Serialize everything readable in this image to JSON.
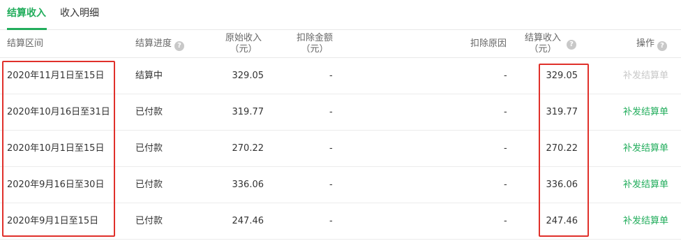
{
  "tabs": [
    {
      "label": "结算收入",
      "active": true
    },
    {
      "label": "收入明细",
      "active": false
    }
  ],
  "columns": {
    "period": "结算区间",
    "progress": "结算进度",
    "original_income": "原始收入",
    "original_income_unit": "（元）",
    "deduction_amount": "扣除金额",
    "deduction_amount_unit": "（元）",
    "deduction_reason": "扣除原因",
    "settled_income": "结算收入",
    "settled_income_unit": "（元）",
    "operation": "操作"
  },
  "help_icon": "question-circle-icon",
  "rows": [
    {
      "period": "2020年11月1日至15日",
      "progress": "结算中",
      "original": "329.05",
      "deduction": "-",
      "reason": "-",
      "settled": "329.05",
      "action": "补发结算单",
      "action_enabled": false
    },
    {
      "period": "2020年10月16日至31日",
      "progress": "已付款",
      "original": "319.77",
      "deduction": "-",
      "reason": "-",
      "settled": "319.77",
      "action": "补发结算单",
      "action_enabled": true
    },
    {
      "period": "2020年10月1日至15日",
      "progress": "已付款",
      "original": "270.22",
      "deduction": "-",
      "reason": "-",
      "settled": "270.22",
      "action": "补发结算单",
      "action_enabled": true
    },
    {
      "period": "2020年9月16日至30日",
      "progress": "已付款",
      "original": "336.06",
      "deduction": "-",
      "reason": "-",
      "settled": "336.06",
      "action": "补发结算单",
      "action_enabled": true
    },
    {
      "period": "2020年9月1日至15日",
      "progress": "已付款",
      "original": "247.46",
      "deduction": "-",
      "reason": "-",
      "settled": "247.46",
      "action": "补发结算单",
      "action_enabled": true
    }
  ],
  "colors": {
    "accent": "#22ad5c",
    "highlight": "#e0302a",
    "disabled": "#c8c8c8"
  }
}
